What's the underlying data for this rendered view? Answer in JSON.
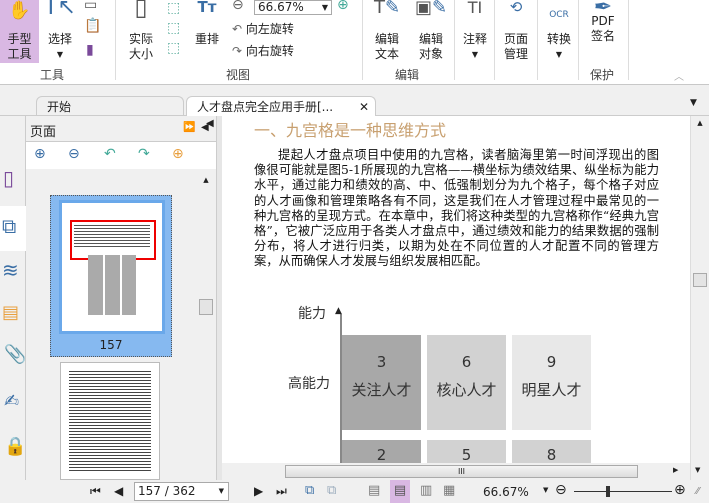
{
  "ribbon": {
    "hand_tool": "手型\n工具",
    "select": "选择",
    "actual_size": "实际\n大小",
    "reflow": "重排",
    "zoom_value": "66.67%",
    "rotate_left": "向左旋转",
    "rotate_right": "向右旋转",
    "edit_text": "编辑\n文本",
    "edit_object": "编辑\n对象",
    "annotate": "注释",
    "page_manage": "页面\n管理",
    "convert": "转换",
    "pdf_sign": "PDF\n签名",
    "groups": {
      "tools": "工具",
      "view": "视图",
      "edit": "编辑",
      "protect": "保护"
    }
  },
  "tabs": [
    {
      "label": "开始"
    },
    {
      "label": "人才盘点完全应用手册[..."
    }
  ],
  "panel": {
    "title": "页面",
    "thumb_label": "157"
  },
  "document": {
    "heading": "一、九宫格是一种思维方式",
    "paragraph": "提起人才盘点项目中使用的九宫格，读者脑海里第一时间浮现出的图像很可能就是图5-1所展现的九宫格——横坐标为绩效结果、纵坐标为能力水平，通过能力和绩效的高、中、低强制划分为九个格子，每个格子对应的人才画像和管理策略各有不同，这是我们在人才管理过程中最常见的一种九宫格的呈现方式。在本章中，我们将这种类型的九宫格称作“经典九宫格”，它被广泛应用于各类人才盘点中，通过绩效和能力的结果数据的强制分布，将人才进行归类，以期为处在不同位置的人才配置不同的管理方案，从而确保人才发展与组织发展相匹配。",
    "figure": {
      "y_axis": "能力",
      "row_label": "高能力",
      "cells": [
        {
          "num": "3",
          "label": "关注人才",
          "color": "#a8a8a8"
        },
        {
          "num": "6",
          "label": "核心人才",
          "color": "#d2d2d2"
        },
        {
          "num": "9",
          "label": "明星人才",
          "color": "#e8e8e8"
        }
      ],
      "row2": [
        {
          "num": "2",
          "color": "#a8a8a8"
        },
        {
          "num": "5",
          "color": "#d2d2d2"
        },
        {
          "num": "8",
          "color": "#d2d2d2"
        }
      ]
    }
  },
  "status": {
    "page_input": "157 / 362",
    "zoom": "66.67%",
    "zoom_slider_percent": 0.35
  }
}
